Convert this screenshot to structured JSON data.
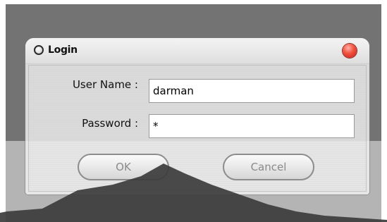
{
  "dialog": {
    "title": "Login",
    "title_icon": "radio-circle-icon",
    "close_icon": "close-icon",
    "fields": {
      "username_label": "User Name :",
      "username_value": "darman",
      "password_label": "Password :",
      "password_value": "*"
    },
    "buttons": {
      "ok_label": "OK",
      "cancel_label": "Cancel"
    }
  },
  "colors": {
    "background_top": "#737373",
    "background_bottom": "#b4b4b4",
    "close_button": "#e8402e",
    "button_text": "#8a8a8a"
  }
}
